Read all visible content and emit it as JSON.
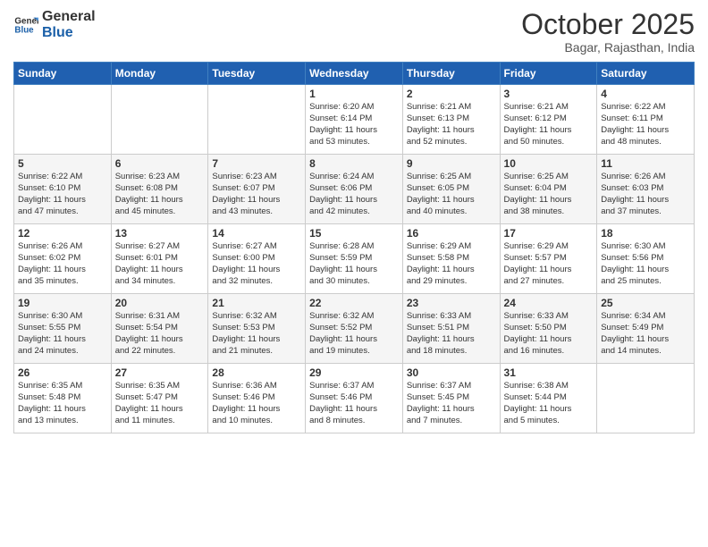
{
  "logo": {
    "line1": "General",
    "line2": "Blue"
  },
  "title": "October 2025",
  "subtitle": "Bagar, Rajasthan, India",
  "weekdays": [
    "Sunday",
    "Monday",
    "Tuesday",
    "Wednesday",
    "Thursday",
    "Friday",
    "Saturday"
  ],
  "weeks": [
    [
      {
        "day": "",
        "info": ""
      },
      {
        "day": "",
        "info": ""
      },
      {
        "day": "",
        "info": ""
      },
      {
        "day": "1",
        "info": "Sunrise: 6:20 AM\nSunset: 6:14 PM\nDaylight: 11 hours\nand 53 minutes."
      },
      {
        "day": "2",
        "info": "Sunrise: 6:21 AM\nSunset: 6:13 PM\nDaylight: 11 hours\nand 52 minutes."
      },
      {
        "day": "3",
        "info": "Sunrise: 6:21 AM\nSunset: 6:12 PM\nDaylight: 11 hours\nand 50 minutes."
      },
      {
        "day": "4",
        "info": "Sunrise: 6:22 AM\nSunset: 6:11 PM\nDaylight: 11 hours\nand 48 minutes."
      }
    ],
    [
      {
        "day": "5",
        "info": "Sunrise: 6:22 AM\nSunset: 6:10 PM\nDaylight: 11 hours\nand 47 minutes."
      },
      {
        "day": "6",
        "info": "Sunrise: 6:23 AM\nSunset: 6:08 PM\nDaylight: 11 hours\nand 45 minutes."
      },
      {
        "day": "7",
        "info": "Sunrise: 6:23 AM\nSunset: 6:07 PM\nDaylight: 11 hours\nand 43 minutes."
      },
      {
        "day": "8",
        "info": "Sunrise: 6:24 AM\nSunset: 6:06 PM\nDaylight: 11 hours\nand 42 minutes."
      },
      {
        "day": "9",
        "info": "Sunrise: 6:25 AM\nSunset: 6:05 PM\nDaylight: 11 hours\nand 40 minutes."
      },
      {
        "day": "10",
        "info": "Sunrise: 6:25 AM\nSunset: 6:04 PM\nDaylight: 11 hours\nand 38 minutes."
      },
      {
        "day": "11",
        "info": "Sunrise: 6:26 AM\nSunset: 6:03 PM\nDaylight: 11 hours\nand 37 minutes."
      }
    ],
    [
      {
        "day": "12",
        "info": "Sunrise: 6:26 AM\nSunset: 6:02 PM\nDaylight: 11 hours\nand 35 minutes."
      },
      {
        "day": "13",
        "info": "Sunrise: 6:27 AM\nSunset: 6:01 PM\nDaylight: 11 hours\nand 34 minutes."
      },
      {
        "day": "14",
        "info": "Sunrise: 6:27 AM\nSunset: 6:00 PM\nDaylight: 11 hours\nand 32 minutes."
      },
      {
        "day": "15",
        "info": "Sunrise: 6:28 AM\nSunset: 5:59 PM\nDaylight: 11 hours\nand 30 minutes."
      },
      {
        "day": "16",
        "info": "Sunrise: 6:29 AM\nSunset: 5:58 PM\nDaylight: 11 hours\nand 29 minutes."
      },
      {
        "day": "17",
        "info": "Sunrise: 6:29 AM\nSunset: 5:57 PM\nDaylight: 11 hours\nand 27 minutes."
      },
      {
        "day": "18",
        "info": "Sunrise: 6:30 AM\nSunset: 5:56 PM\nDaylight: 11 hours\nand 25 minutes."
      }
    ],
    [
      {
        "day": "19",
        "info": "Sunrise: 6:30 AM\nSunset: 5:55 PM\nDaylight: 11 hours\nand 24 minutes."
      },
      {
        "day": "20",
        "info": "Sunrise: 6:31 AM\nSunset: 5:54 PM\nDaylight: 11 hours\nand 22 minutes."
      },
      {
        "day": "21",
        "info": "Sunrise: 6:32 AM\nSunset: 5:53 PM\nDaylight: 11 hours\nand 21 minutes."
      },
      {
        "day": "22",
        "info": "Sunrise: 6:32 AM\nSunset: 5:52 PM\nDaylight: 11 hours\nand 19 minutes."
      },
      {
        "day": "23",
        "info": "Sunrise: 6:33 AM\nSunset: 5:51 PM\nDaylight: 11 hours\nand 18 minutes."
      },
      {
        "day": "24",
        "info": "Sunrise: 6:33 AM\nSunset: 5:50 PM\nDaylight: 11 hours\nand 16 minutes."
      },
      {
        "day": "25",
        "info": "Sunrise: 6:34 AM\nSunset: 5:49 PM\nDaylight: 11 hours\nand 14 minutes."
      }
    ],
    [
      {
        "day": "26",
        "info": "Sunrise: 6:35 AM\nSunset: 5:48 PM\nDaylight: 11 hours\nand 13 minutes."
      },
      {
        "day": "27",
        "info": "Sunrise: 6:35 AM\nSunset: 5:47 PM\nDaylight: 11 hours\nand 11 minutes."
      },
      {
        "day": "28",
        "info": "Sunrise: 6:36 AM\nSunset: 5:46 PM\nDaylight: 11 hours\nand 10 minutes."
      },
      {
        "day": "29",
        "info": "Sunrise: 6:37 AM\nSunset: 5:46 PM\nDaylight: 11 hours\nand 8 minutes."
      },
      {
        "day": "30",
        "info": "Sunrise: 6:37 AM\nSunset: 5:45 PM\nDaylight: 11 hours\nand 7 minutes."
      },
      {
        "day": "31",
        "info": "Sunrise: 6:38 AM\nSunset: 5:44 PM\nDaylight: 11 hours\nand 5 minutes."
      },
      {
        "day": "",
        "info": ""
      }
    ]
  ]
}
